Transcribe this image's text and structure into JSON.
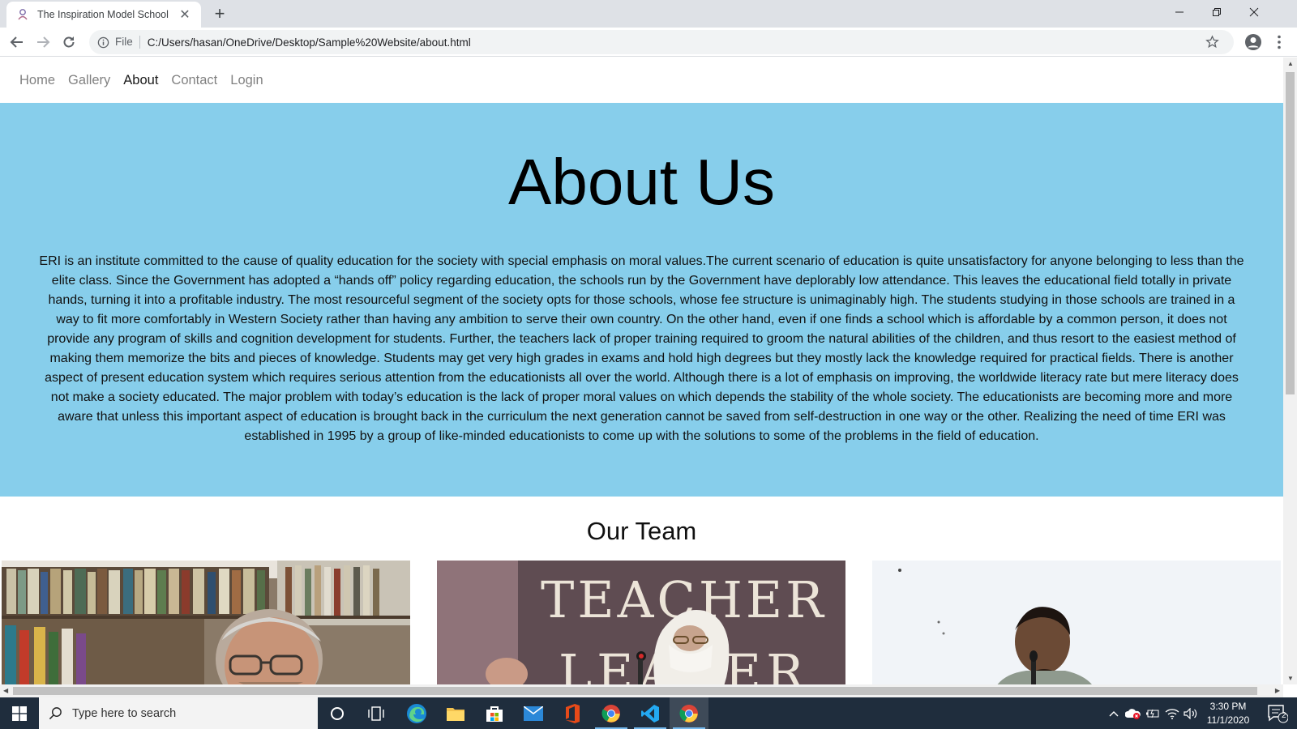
{
  "browser": {
    "tab_title": "The Inspiration Model School",
    "url_scheme_label": "File",
    "url": "C:/Users/hasan/OneDrive/Desktop/Sample%20Website/about.html"
  },
  "site_nav": {
    "items": [
      "Home",
      "Gallery",
      "About",
      "Contact",
      "Login"
    ],
    "active": "About"
  },
  "hero": {
    "heading": "About Us",
    "body": "ERI is an institute committed to the cause of quality education for the society with special emphasis on moral values.The current scenario of education is quite unsatisfactory for anyone belonging to less than the elite class. Since the Government has adopted a “hands off” policy regarding education, the schools run by the Government have deplorably low attendance. This leaves the educational field totally in private hands, turning it into a profitable industry. The most resourceful segment of the society opts for those schools, whose fee structure is unimaginably high. The students studying in those schools are trained in a way to fit more comfortably in Western Society rather than having any ambition to serve their own country. On the other hand, even if one finds a school which is affordable by a common person, it does not provide any program of skills and cognition development for students. Further, the teachers lack of proper training required to groom the natural abilities of the children, and thus resort to the easiest method of making them memorize the bits and pieces of knowledge. Students may get very high grades in exams and hold high degrees but they mostly lack the knowledge required for practical fields. There is another aspect of present education system which requires serious attention from the educationists all over the world. Although there is a lot of emphasis on improving, the worldwide literacy rate but mere literacy does not make a society educated. The major problem with today’s education is the lack of proper moral values on which depends the stability of the whole society. The educationists are becoming more and more aware that unless this important aspect of education is brought back in the curriculum the next generation cannot be saved from self-destruction in one way or the other. Realizing the need of time ERI was established in 1995 by a group of like-minded educationists to come up with the solutions to some of the problems in the field of education."
  },
  "team": {
    "heading": "Our Team",
    "photos": [
      {
        "depicts": "older man with glasses in front of bookshelves"
      },
      {
        "depicts": "woman speaking at microphone before chalkboard",
        "board_text_1": "TEACHER",
        "board_text_2": "LEADER"
      },
      {
        "depicts": "man speaking at microphone against white background"
      }
    ]
  },
  "taskbar": {
    "search_placeholder": "Type here to search",
    "time": "3:30 PM",
    "date": "11/1/2020",
    "notification_count": "2",
    "pinned_icons": [
      "cortana-icon",
      "task-view-icon",
      "edge-icon",
      "file-explorer-icon",
      "store-icon",
      "mail-icon",
      "office-icon",
      "chrome-icon",
      "vscode-icon",
      "chrome-icon"
    ]
  },
  "colors": {
    "hero_background": "#87ceeb",
    "taskbar": "#1f2d3d",
    "tabstrip": "#dee1e6"
  }
}
